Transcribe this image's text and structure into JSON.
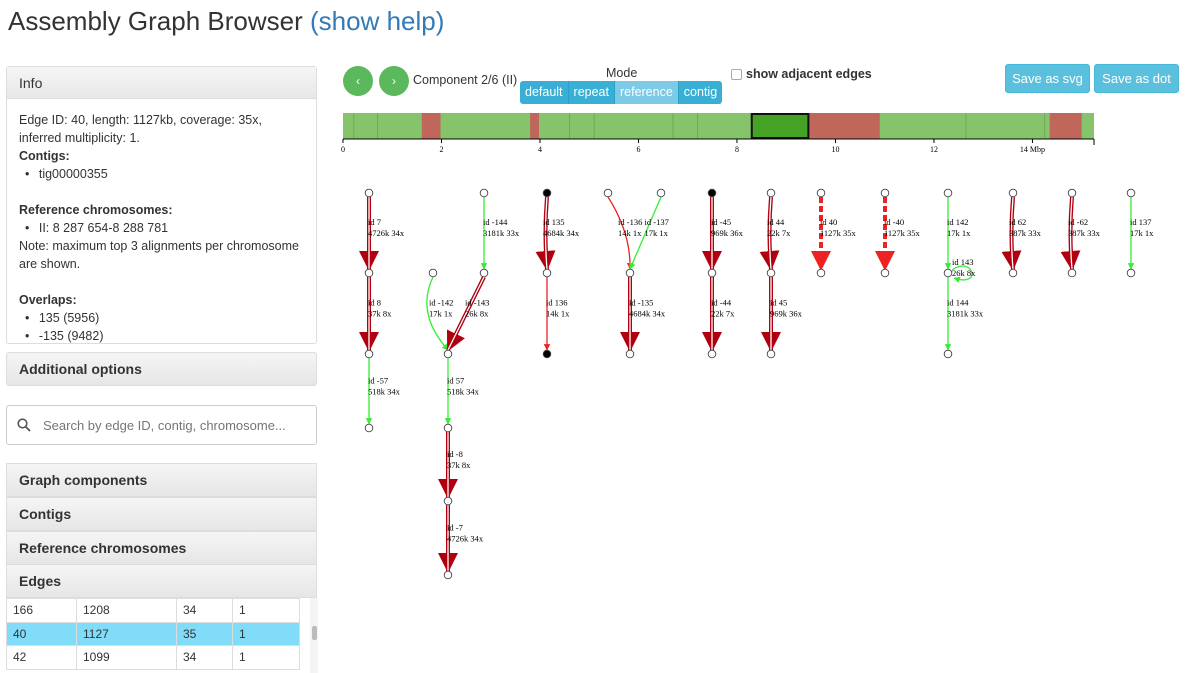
{
  "header": {
    "title": "Assembly Graph Browser",
    "help_link": "(show help)"
  },
  "info": {
    "title": "Info",
    "edge_text": "Edge ID: 40, length: 1127kb, coverage: 35x, inferred multiplicity: 1.",
    "contigs_label": "Contigs:",
    "contigs": [
      "tig00000355"
    ],
    "ref_label": "Reference chromosomes:",
    "refs": [
      "II: 8 287 654-8 288 781"
    ],
    "note": "Note: maximum top 3 alignments per chromosome are shown.",
    "overlaps_label": "Overlaps:",
    "overlaps": [
      "135 (5956)",
      "-135 (9482)"
    ]
  },
  "additional_options": "Additional options",
  "search": {
    "placeholder": "Search by edge ID, contig, chromosome...",
    "icon": "search-icon"
  },
  "accordions": [
    "Graph components",
    "Contigs",
    "Reference chromosomes",
    "Edges"
  ],
  "edges_table": [
    [
      "166",
      "1208",
      "34",
      "1"
    ],
    [
      "40",
      "1127",
      "35",
      "1"
    ],
    [
      "42",
      "1099",
      "34",
      "1"
    ]
  ],
  "selected_row": 1,
  "toolbar": {
    "prev": "‹",
    "next": "›",
    "component": "Component 2/6 (II)",
    "mode_label": "Mode",
    "modes": [
      "default",
      "repeat",
      "reference",
      "contig"
    ],
    "active_mode": "reference",
    "adjacent_label": "show adjacent edges",
    "adjacent_checked": false,
    "save_svg": "Save as svg",
    "save_dot": "Save as dot"
  },
  "colors": {
    "primary": "#5bc0de",
    "success": "#5cb85c",
    "selected_row": "#80dcf8",
    "aligned": "#85c46a",
    "unaligned": "#c0665a",
    "selected_segment": "#45a224",
    "repeat_edge": "#b00010",
    "green_edge": "#33ee33",
    "red_edge": "#ee2222"
  },
  "chromosome_track": {
    "range_mbp": [
      0,
      15.25
    ],
    "ticks": [
      "0",
      "2",
      "4",
      "6",
      "8",
      "10",
      "12",
      "14 Mbp"
    ],
    "unaligned_segments": [
      [
        1.6,
        1.98
      ],
      [
        3.8,
        3.98
      ],
      [
        9.45,
        10.9
      ],
      [
        14.35,
        15.0
      ]
    ],
    "selected_segment": [
      8.3,
      9.45
    ],
    "dividers": [
      0.22,
      0.7,
      4.6,
      5.1,
      6.7,
      7.2,
      12.65,
      14.25
    ]
  },
  "graph": {
    "edges": [
      {
        "id": "7",
        "len": "4726k",
        "cov": "34x",
        "type": "repeat"
      },
      {
        "id": "8",
        "len": "37k",
        "cov": "8x",
        "type": "repeat"
      },
      {
        "id": "-57",
        "len": "518k",
        "cov": "34x",
        "type": "green"
      },
      {
        "id": "-144",
        "len": "3181k",
        "cov": "33x",
        "type": "green"
      },
      {
        "id": "-142",
        "len": "17k",
        "cov": "1x",
        "type": "green"
      },
      {
        "id": "-143",
        "len": "26k",
        "cov": "8x",
        "type": "repeat"
      },
      {
        "id": "57",
        "len": "518k",
        "cov": "34x",
        "type": "green"
      },
      {
        "id": "-8",
        "len": "37k",
        "cov": "8x",
        "type": "repeat"
      },
      {
        "id": "-7",
        "len": "4726k",
        "cov": "34x",
        "type": "repeat"
      },
      {
        "id": "135",
        "len": "4684k",
        "cov": "34x",
        "type": "repeat"
      },
      {
        "id": "136",
        "len": "14k",
        "cov": "1x",
        "type": "red"
      },
      {
        "id": "-136",
        "len": "14k",
        "cov": "1x",
        "type": "red"
      },
      {
        "id": "-137",
        "len": "17k",
        "cov": "1x",
        "type": "green"
      },
      {
        "id": "-135",
        "len": "4684k",
        "cov": "34x",
        "type": "repeat"
      },
      {
        "id": "-45",
        "len": "969k",
        "cov": "36x",
        "type": "repeat"
      },
      {
        "id": "-44",
        "len": "22k",
        "cov": "7x",
        "type": "repeat"
      },
      {
        "id": "44",
        "len": "22k",
        "cov": "7x",
        "type": "repeat"
      },
      {
        "id": "45",
        "len": "969k",
        "cov": "36x",
        "type": "repeat"
      },
      {
        "id": "40",
        "len": "1127k",
        "cov": "35x",
        "type": "selected"
      },
      {
        "id": "-40",
        "len": "1127k",
        "cov": "35x",
        "type": "selected"
      },
      {
        "id": "142",
        "len": "17k",
        "cov": "1x",
        "type": "green"
      },
      {
        "id": "143",
        "len": "26k",
        "cov": "8x",
        "type": "green"
      },
      {
        "id": "144",
        "len": "3181k",
        "cov": "33x",
        "type": "green"
      },
      {
        "id": "62",
        "len": "387k",
        "cov": "33x",
        "type": "repeat"
      },
      {
        "id": "-62",
        "len": "387k",
        "cov": "33x",
        "type": "repeat"
      },
      {
        "id": "137",
        "len": "17k",
        "cov": "1x",
        "type": "green"
      }
    ]
  }
}
